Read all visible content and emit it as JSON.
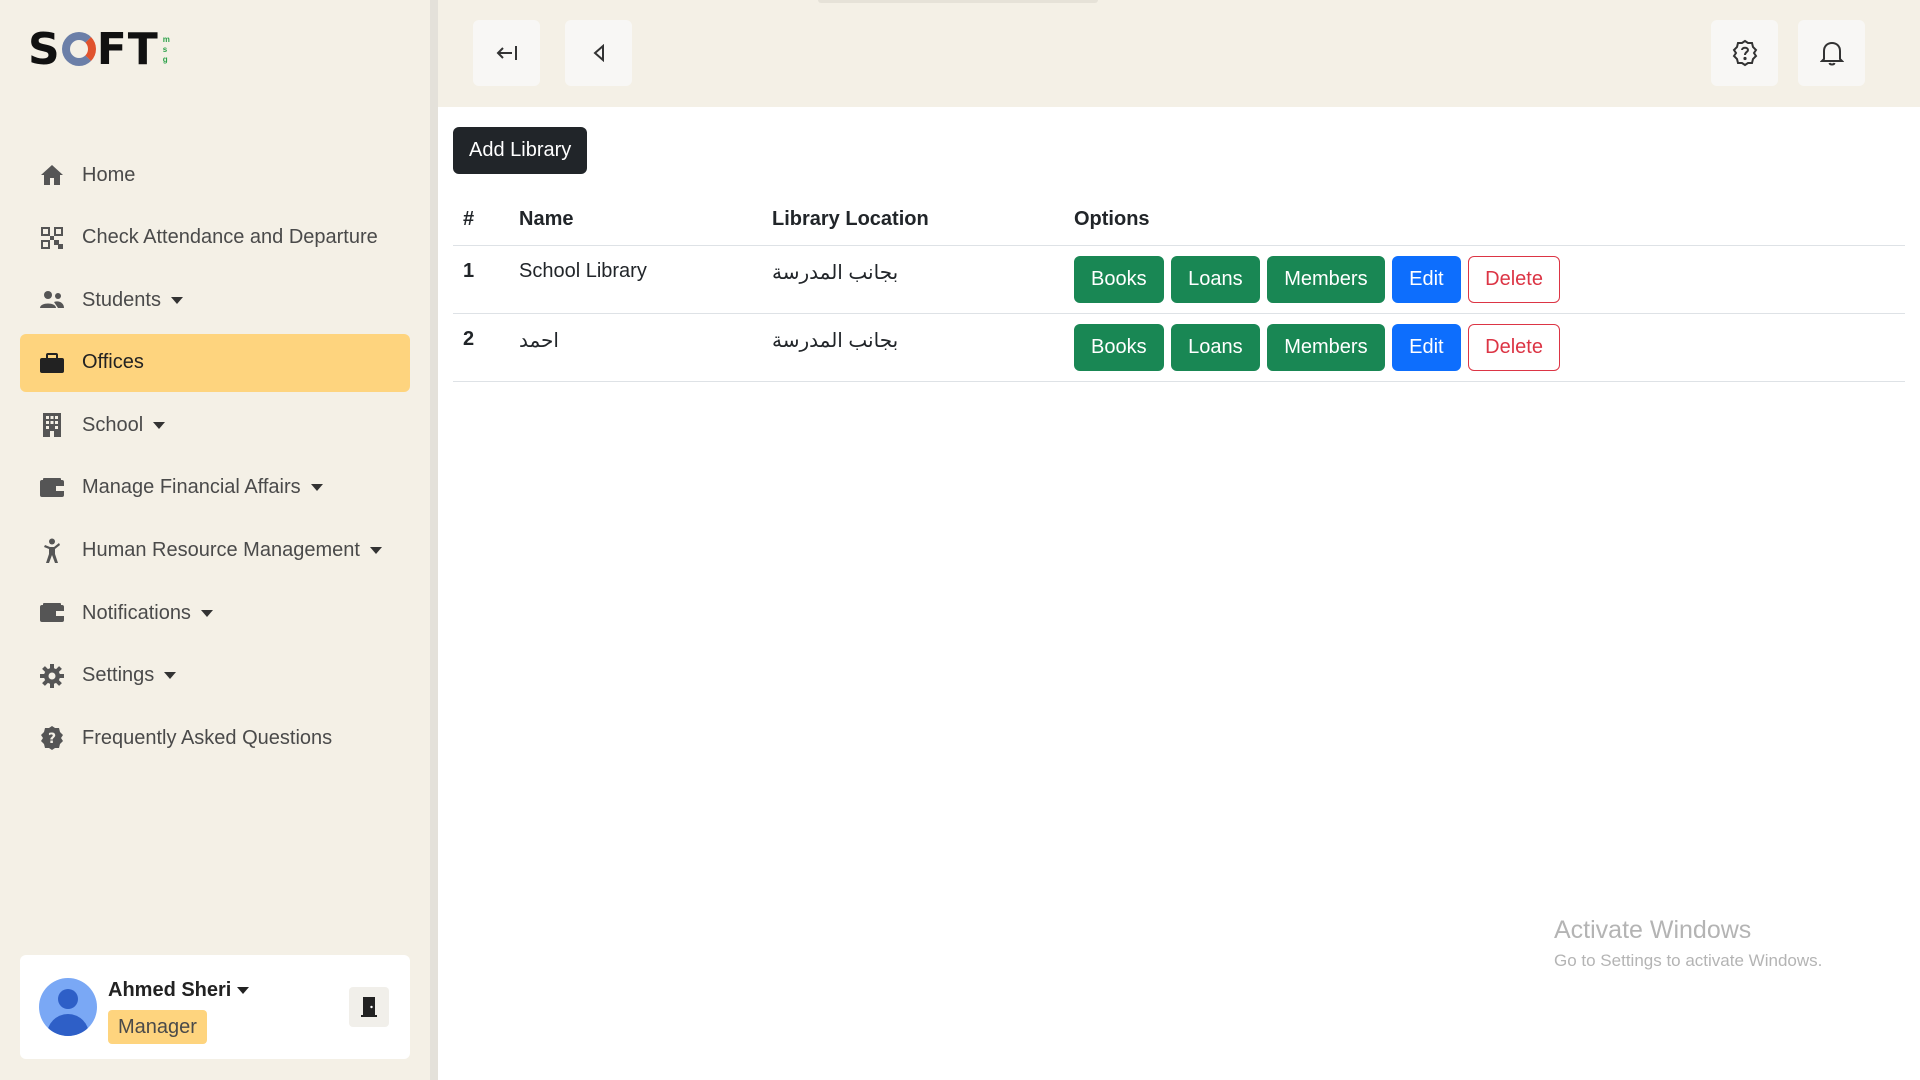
{
  "app": {
    "logo_text": "S FT",
    "logo_sub": [
      "m",
      "s",
      "g"
    ]
  },
  "sidebar": {
    "items": [
      {
        "label": "Home",
        "icon": "home-icon",
        "caret": false,
        "active": false
      },
      {
        "label": "Check Attendance and Departure",
        "icon": "qr-code-icon",
        "caret": false,
        "active": false
      },
      {
        "label": "Students",
        "icon": "users-icon",
        "caret": true,
        "active": false
      },
      {
        "label": "Offices",
        "icon": "briefcase-icon",
        "caret": false,
        "active": true
      },
      {
        "label": "School",
        "icon": "building-icon",
        "caret": true,
        "active": false
      },
      {
        "label": "Manage Financial Affairs",
        "icon": "wallet-icon",
        "caret": true,
        "active": false
      },
      {
        "label": "Human Resource Management",
        "icon": "person-icon",
        "caret": true,
        "active": false
      },
      {
        "label": "Notifications",
        "icon": "inbox-icon",
        "caret": true,
        "active": false
      },
      {
        "label": "Settings",
        "icon": "gear-icon",
        "caret": true,
        "active": false
      },
      {
        "label": "Frequently Asked Questions",
        "icon": "question-circle-icon",
        "caret": false,
        "active": false
      }
    ],
    "user": {
      "name": "Ahmed Sheri",
      "role": "Manager"
    }
  },
  "main": {
    "add_button": "Add Library",
    "table": {
      "headers": [
        "#",
        "Name",
        "Library Location",
        "Options"
      ],
      "rows": [
        {
          "num": "1",
          "name": "School Library",
          "location": "بجانب المدرسة"
        },
        {
          "num": "2",
          "name": "احمد",
          "location": "بجانب المدرسة"
        }
      ],
      "options": {
        "books": "Books",
        "loans": "Loans",
        "members": "Members",
        "edit": "Edit",
        "delete": "Delete"
      }
    }
  },
  "colors": {
    "active_nav": "#fed47e",
    "success": "#198754",
    "primary": "#0d6efd",
    "danger": "#dc3545",
    "dark": "#212529"
  },
  "watermark": {
    "line1": "Activate Windows",
    "line2": "Go to Settings to activate Windows."
  }
}
